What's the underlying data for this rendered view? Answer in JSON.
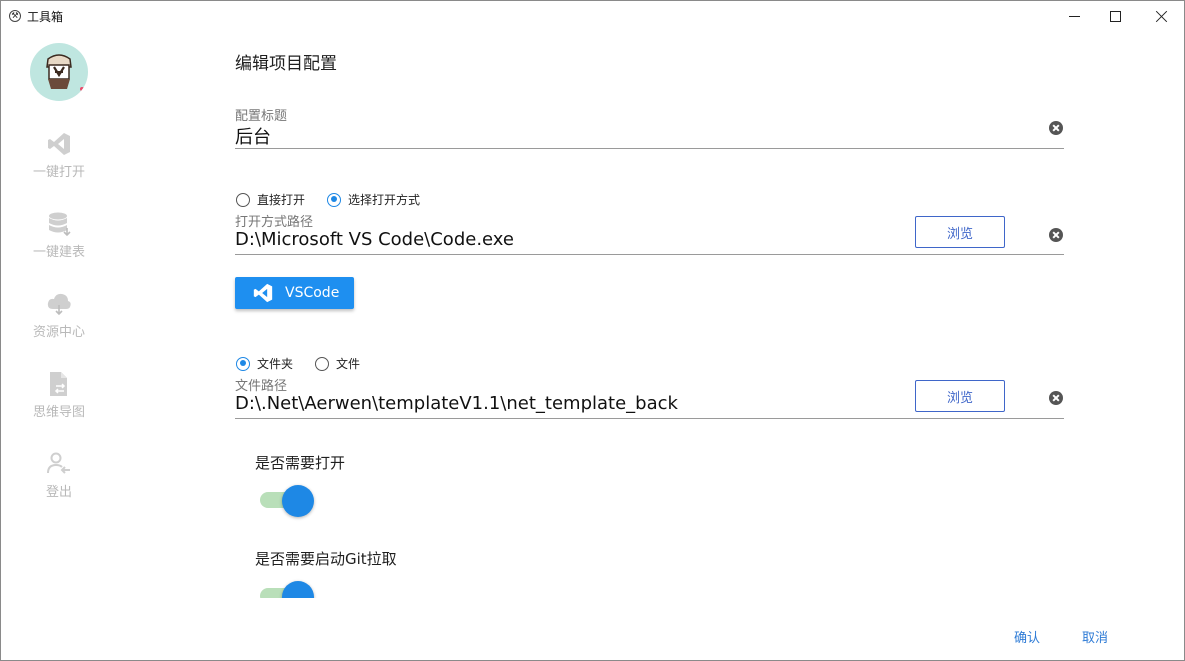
{
  "window": {
    "title": "工具箱"
  },
  "sidebar": {
    "items": [
      {
        "label": "一键打开",
        "icon": "vscode-icon"
      },
      {
        "label": "一键建表",
        "icon": "database-icon"
      },
      {
        "label": "资源中心",
        "icon": "cloud-download-icon"
      },
      {
        "label": "思维导图",
        "icon": "file-sync-icon"
      },
      {
        "label": "登出",
        "icon": "user-logout-icon"
      }
    ]
  },
  "form": {
    "title": "编辑项目配置",
    "config_title": {
      "label": "配置标题",
      "value": "后台"
    },
    "open_mode": {
      "options": [
        {
          "label": "直接打开",
          "checked": false
        },
        {
          "label": "选择打开方式",
          "checked": true
        }
      ]
    },
    "open_path": {
      "label": "打开方式路径",
      "value": "D:\\Microsoft VS Code\\Code.exe",
      "browse_label": "浏览"
    },
    "vscode_button": {
      "label": "VSCode"
    },
    "target_type": {
      "options": [
        {
          "label": "文件夹",
          "checked": true
        },
        {
          "label": "文件",
          "checked": false
        }
      ]
    },
    "file_path": {
      "label": "文件路径",
      "value": "D:\\.Net\\Aerwen\\templateV1.1\\net_template_back",
      "browse_label": "浏览"
    },
    "need_open": {
      "label": "是否需要打开",
      "enabled": true
    },
    "need_git": {
      "label": "是否需要启动Git拉取",
      "enabled": true
    }
  },
  "footer": {
    "confirm_label": "确认",
    "cancel_label": "取消"
  },
  "colors": {
    "accent": "#1e88e5",
    "link": "#2e7bd6",
    "browse_border": "#3f66c9",
    "toggle_track": "#b9dfb9",
    "sidebar_text": "#b9b9b9"
  }
}
